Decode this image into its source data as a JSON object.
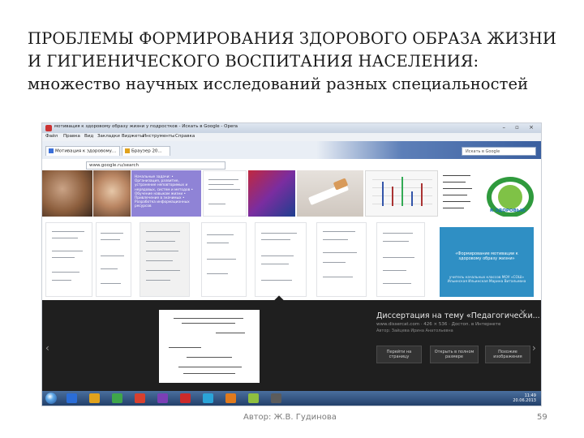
{
  "slide": {
    "title_line1": "ПРОБЛЕМЫ ФОРМИРОВАНИЯ ЗДОРОВОГО ОБРАЗА ЖИЗНИ",
    "title_line2": "И ГИГИЕНИЧЕСКОГО ВОСПИТАНИЯ НАСЕЛЕНИЯ:",
    "subtitle": "множество научных исследований разных специальностей",
    "author": "Автор: Ж.В. Гудинова",
    "page_number": "59"
  },
  "browser": {
    "window_title": "мотивация к здоровому образу жизни у подростков - Искать в Google - Opera",
    "window_buttons": "– ▫ ×",
    "menu": [
      "Файл",
      "Правка",
      "Вид",
      "Закладки",
      "Виджеты",
      "Инструменты",
      "Справка"
    ],
    "tabs": [
      "Мотивация к здоровому...",
      "Браузер 20..."
    ],
    "search_placeholder": "Искать в Google",
    "address": "www.google.ru/search",
    "purple_tile_text": "Начальные задачи: • Организация, развитие, устранение неповторимых и нерядовых, систем и методов • Обучение навыкам жизни • Привлечение в значимых • Разработка информационных ресурсов",
    "logo_text": "К ЗДОРОВЬЮ",
    "blue_tile_title": "«Формирование мотивации к здоровому образу жизни»",
    "blue_tile_sub": "учитель начальных классов МОУ «СОШ» Ильинская Ильинская Марина Витальевна",
    "detail_title": "Диссертация на тему «Педагогически...",
    "detail_url": "www.dissercat.com · 426 × 536 · Достоп. в Интернете",
    "detail_sub": "Автор: Зайцева Ирина Анатольевна",
    "detail_buttons": [
      "Перейти на страницу",
      "Открыть в полном размере",
      "Похожие изображения"
    ],
    "close_icon": "×",
    "prev_icon": "‹",
    "next_icon": "›"
  },
  "taskbar": {
    "time": "11:49",
    "date": "20.06.2013",
    "icon_colors": [
      "#2a6dd8",
      "#e0a21d",
      "#3fa64a",
      "#d8402e",
      "#7b3fb5",
      "#cc2a2a",
      "#2aa4d8",
      "#e07a1d",
      "#8fbf3f",
      "#5c5c5c"
    ]
  }
}
